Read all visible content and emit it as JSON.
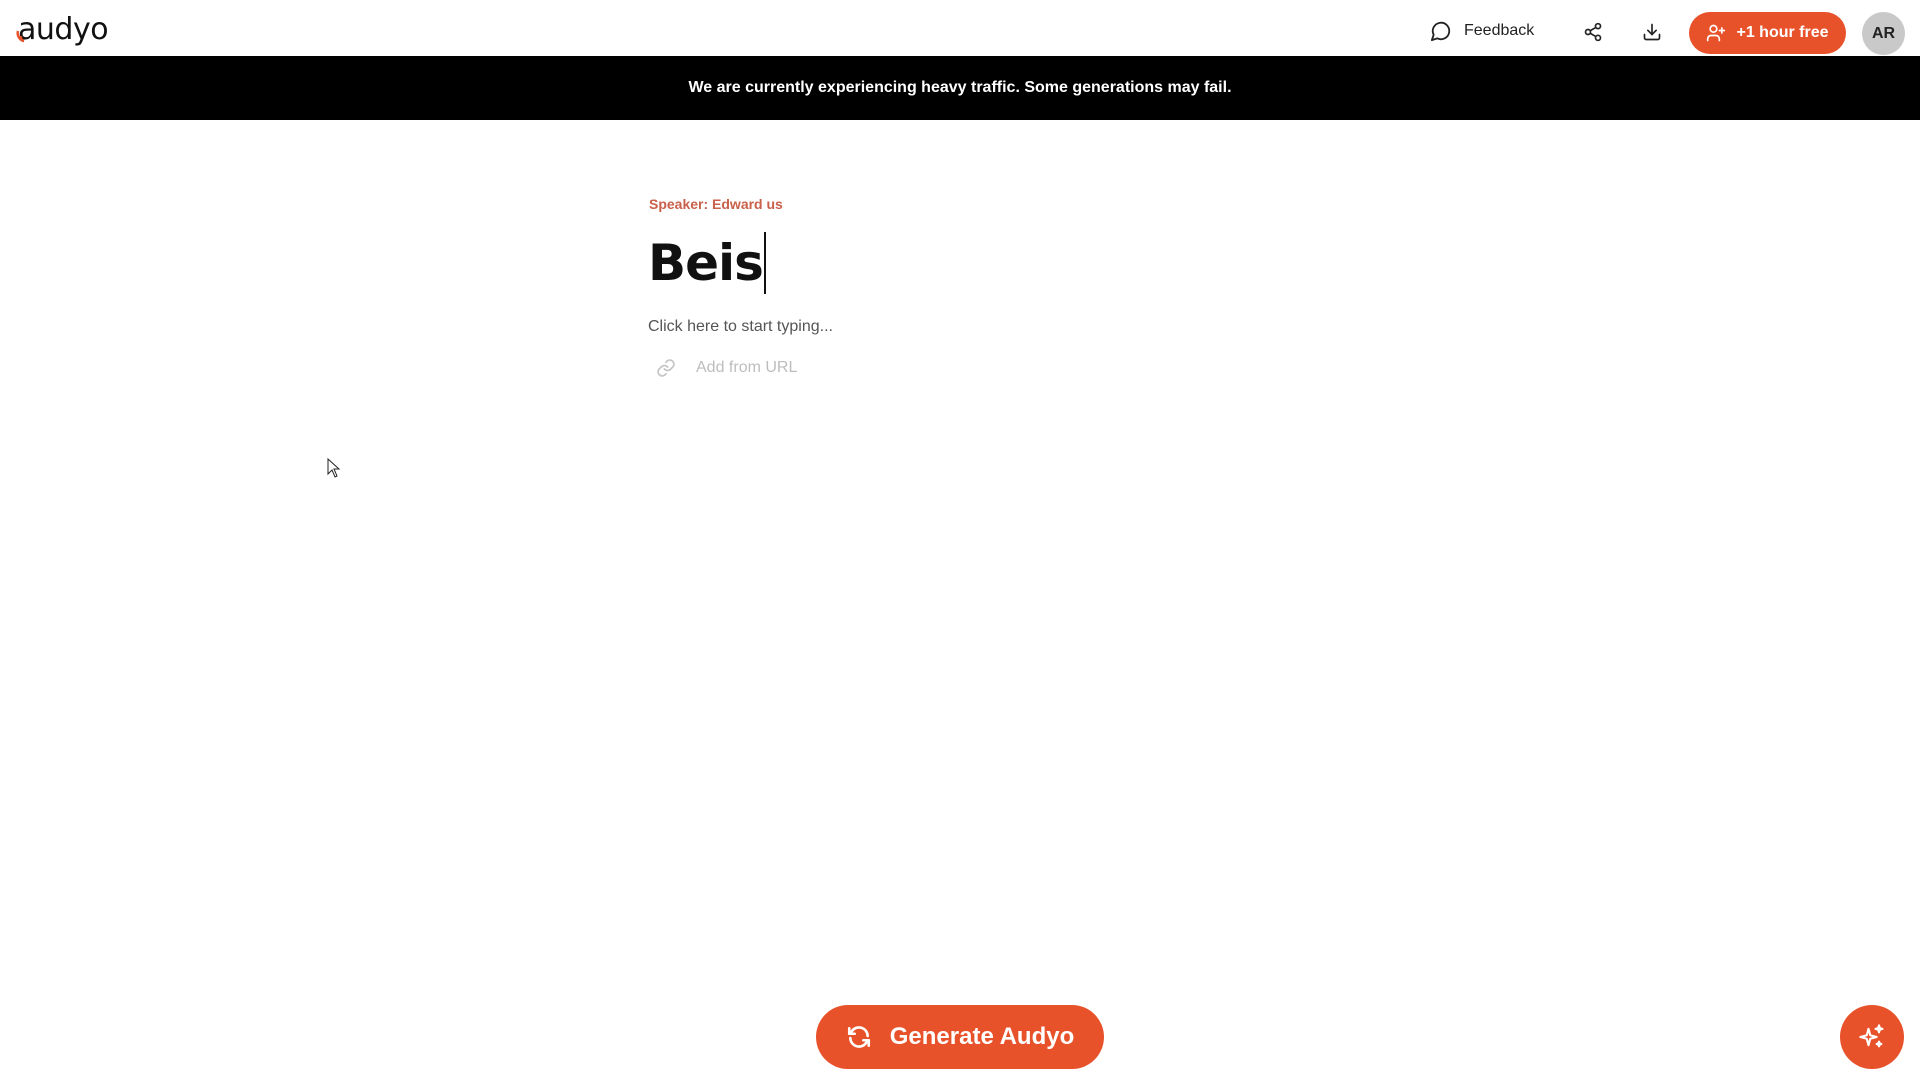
{
  "header": {
    "logo_text": "audyo",
    "feedback_label": "Feedback",
    "share_icon": "share-icon",
    "download_icon": "download-icon",
    "free_button_label": "+1 hour free",
    "avatar_initials": "AR"
  },
  "banner": {
    "message": "We are currently experiencing heavy traffic. Some generations may fail."
  },
  "editor": {
    "speaker_label": "Speaker: Edward us",
    "title_value": "Beis",
    "body_placeholder": "Click here to start typing...",
    "add_url_label": "Add from URL"
  },
  "footer": {
    "generate_label": "Generate Audyo"
  },
  "colors": {
    "accent": "#E8522A",
    "speaker": "#C9604A",
    "banner_bg": "#000000",
    "avatar_bg": "#C9C9C9"
  }
}
